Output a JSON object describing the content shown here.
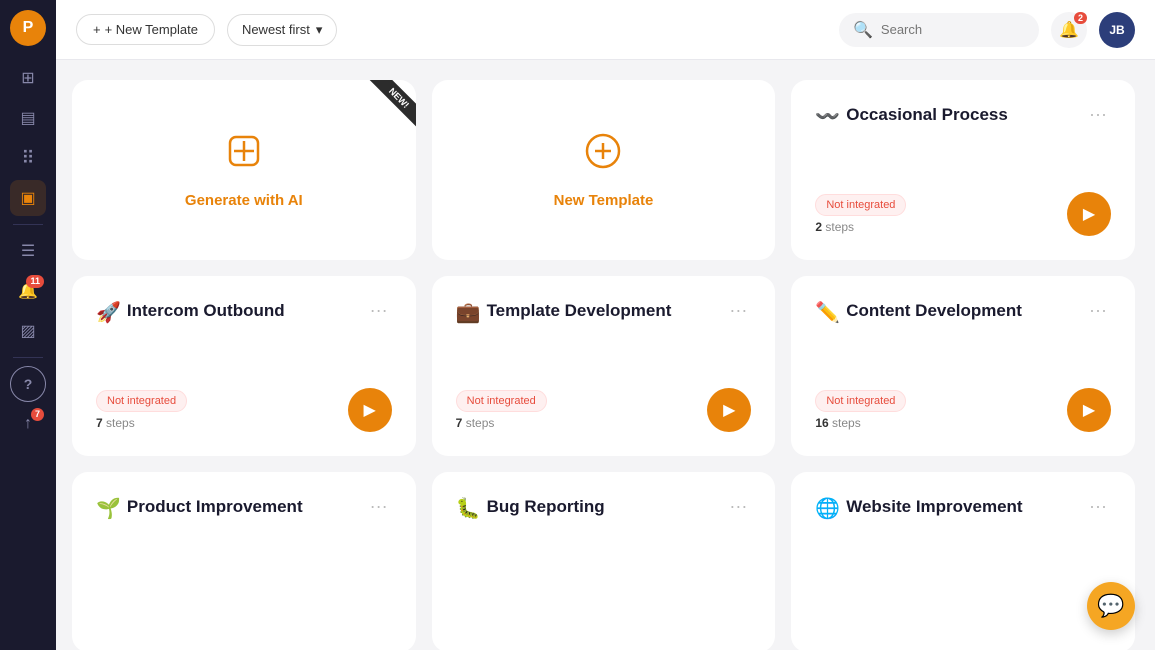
{
  "sidebar": {
    "logo_text": "P",
    "icons": [
      {
        "name": "grid-icon",
        "symbol": "⊞",
        "active": false
      },
      {
        "name": "dashboard-icon",
        "symbol": "▤",
        "active": false
      },
      {
        "name": "apps-icon",
        "symbol": "⠿",
        "active": false
      },
      {
        "name": "presentation-icon",
        "symbol": "▣",
        "active": true
      },
      {
        "name": "list-icon",
        "symbol": "☰",
        "active": false
      },
      {
        "name": "bell-icon",
        "symbol": "🔔",
        "active": false,
        "badge": "11"
      },
      {
        "name": "monitor-icon",
        "symbol": "▨",
        "active": false
      },
      {
        "name": "help-icon",
        "symbol": "?",
        "active": false
      },
      {
        "name": "share-icon",
        "symbol": "↑",
        "active": false,
        "badge": "7"
      }
    ]
  },
  "topbar": {
    "new_template_label": "+ New Template",
    "sort_label": "Newest first",
    "search_placeholder": "Search",
    "notification_badge": "2",
    "avatar_text": "JB"
  },
  "cards": [
    {
      "id": "generate-ai",
      "type": "ai",
      "icon": "✚",
      "label": "Generate with AI",
      "is_new": true
    },
    {
      "id": "new-template",
      "type": "new",
      "icon": "⊕",
      "label": "New Template"
    },
    {
      "id": "occasional-process",
      "type": "regular",
      "emoji": "〰",
      "title": "Occasional Process",
      "not_integrated": true,
      "not_integrated_label": "Not integrated",
      "steps": 2,
      "steps_label": "steps"
    },
    {
      "id": "intercom-outbound",
      "type": "regular",
      "emoji": "🚀",
      "title": "Intercom Outbound",
      "not_integrated": true,
      "not_integrated_label": "Not integrated",
      "steps": 7,
      "steps_label": "steps"
    },
    {
      "id": "template-development",
      "type": "regular",
      "emoji": "💼",
      "title": "Template Development",
      "not_integrated": true,
      "not_integrated_label": "Not integrated",
      "steps": 7,
      "steps_label": "steps"
    },
    {
      "id": "content-development",
      "type": "regular",
      "emoji": "✏️",
      "title": "Content Development",
      "not_integrated": true,
      "not_integrated_label": "Not integrated",
      "steps": 16,
      "steps_label": "steps"
    },
    {
      "id": "product-improvement",
      "type": "regular",
      "emoji": "🌱",
      "title": "Product Improvement",
      "not_integrated": false,
      "steps": null,
      "steps_label": null
    },
    {
      "id": "bug-reporting",
      "type": "regular",
      "emoji": "🐛",
      "title": "Bug Reporting",
      "not_integrated": false,
      "steps": null,
      "steps_label": null
    },
    {
      "id": "website-improvement",
      "type": "regular",
      "emoji": "🌐",
      "title": "Website Improvement",
      "not_integrated": false,
      "steps": null,
      "steps_label": null
    }
  ],
  "chat_button": {
    "symbol": "💬"
  }
}
